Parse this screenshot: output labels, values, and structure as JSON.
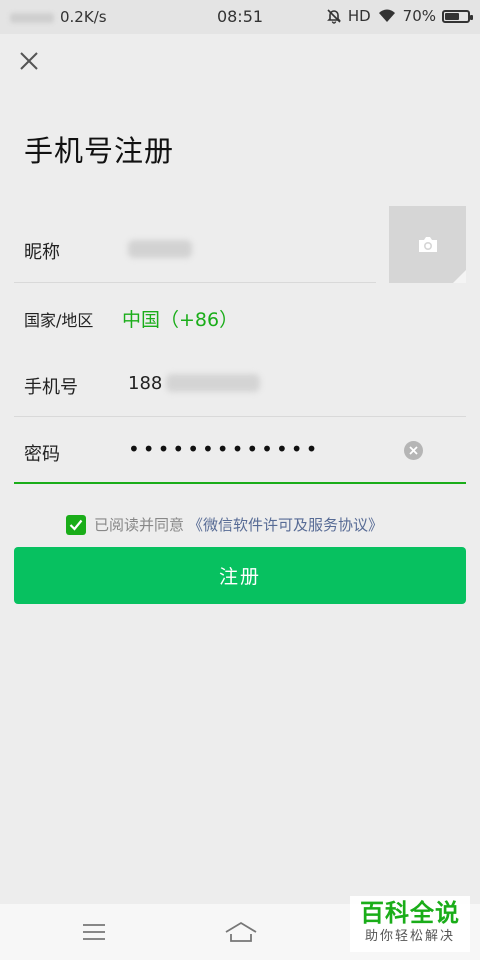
{
  "status_bar": {
    "network_speed": "0.2K/s",
    "time": "08:51",
    "network_type": "HD",
    "battery": "70%",
    "battery_level": 0.7
  },
  "page": {
    "title": "手机号注册"
  },
  "form": {
    "nickname": {
      "label": "昵称"
    },
    "country": {
      "label": "国家/地区",
      "value": "中国（+86）"
    },
    "phone": {
      "label": "手机号",
      "value_prefix": "188"
    },
    "password": {
      "label": "密码",
      "value_mask": "•••••••••••••"
    }
  },
  "agreement": {
    "checked": true,
    "text": "已阅读并同意",
    "link": "《微信软件许可及服务协议》"
  },
  "submit": {
    "label": "注册"
  },
  "watermark": {
    "main": "百科全说",
    "sub": "助你轻松解决"
  },
  "colors": {
    "accent_green": "#1aad19",
    "button_green": "#07c160",
    "link_blue": "#576b95",
    "background": "#ededed"
  },
  "icons": {
    "close": "close-icon",
    "camera": "camera-icon",
    "clear": "clear-icon",
    "check": "checkmark-icon",
    "nav_menu": "menu-icon",
    "nav_home": "home-icon"
  }
}
